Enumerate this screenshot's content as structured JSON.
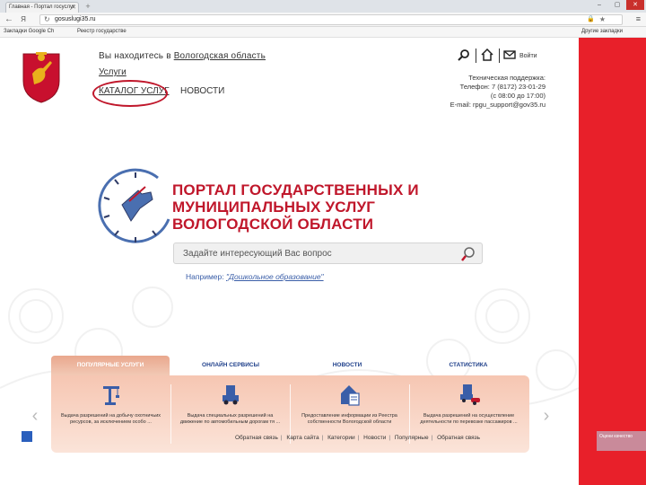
{
  "browser": {
    "tab_title": "Главная - Портал госуслуг",
    "address": "gosuslugi35.ru",
    "bookmarks": [
      "Закладки Google Ch",
      "Реестр государстве"
    ],
    "other_bookmarks": "Другие закладки"
  },
  "header": {
    "region_prefix": "Вы находитесь в",
    "region_link": "Вологодская область",
    "links": [
      "Услуги",
      "КАТАЛОГ УСЛУГ",
      "НОВОСТИ"
    ],
    "login": "Войти",
    "support": [
      "Техническая поддержка:",
      "Телефон: 7 (8172) 23-01-29",
      "(с 08:00 до 17:00)",
      "E-mail: rpgu_support@gov35.ru"
    ]
  },
  "portal": {
    "title_lines": [
      "ПОРТАЛ ГОСУДАРСТВЕННЫХ И",
      "МУНИЦИПАЛЬНЫХ УСЛУГ",
      "ВОЛОГОДСКОЙ ОБЛАСТИ"
    ]
  },
  "search": {
    "placeholder": "Задайте интересующий Вас вопрос",
    "example_label": "Например:",
    "example_link": "\"Дошкольное образование\""
  },
  "service_tabs": [
    "ПОПУЛЯРНЫЕ УСЛУГИ",
    "ОНЛАЙН СЕРВИСЫ",
    "НОВОСТИ",
    "СТАТИСТИКА"
  ],
  "cards": [
    {
      "icon": "crane-icon",
      "text": "Выдача разрешений на добычу охотничьих ресурсов, за исключением особо ..."
    },
    {
      "icon": "truck-icon",
      "text": "Выдача специальных разрешений на движение по автомобильным дорогам тя ..."
    },
    {
      "icon": "house-document-icon",
      "text": "Предоставление информации из Реестра собственности Вологодской области"
    },
    {
      "icon": "truck-car-icon",
      "text": "Выдача разрешений на осуществление деятельности по перевозке пассажиров ..."
    }
  ],
  "footer": [
    "Обратная связь",
    "Карта сайта",
    "Категории",
    "Новости",
    "Популярные",
    "Обратная связь"
  ],
  "side_tab_text": "Оцени качество",
  "colors": {
    "brand_red": "#c0172b",
    "side_red": "#e8202a",
    "tab_blue": "#1e3f8a",
    "panel_peach": "#f6c6b2"
  }
}
